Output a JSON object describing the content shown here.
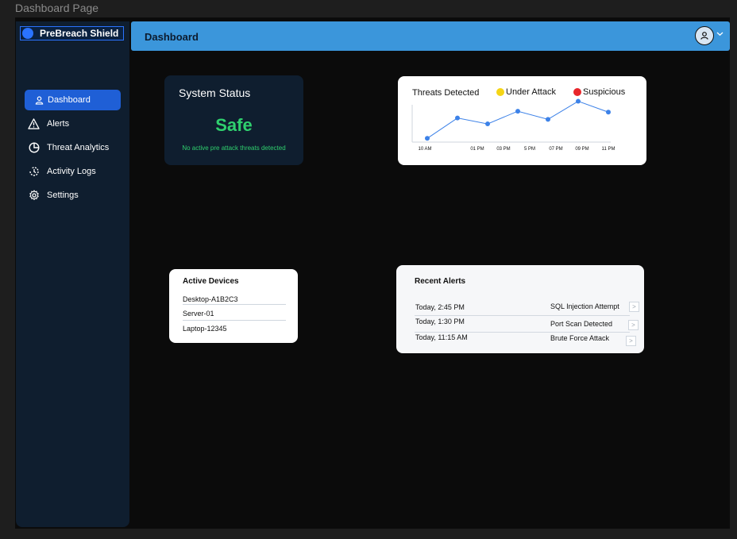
{
  "page_label": "Dashboard Page",
  "app": {
    "logo_text": "PreBreach Shield"
  },
  "sidebar": {
    "items": [
      {
        "label": "Dashboard",
        "icon": "user-icon",
        "active": true
      },
      {
        "label": "Alerts",
        "icon": "warning-icon"
      },
      {
        "label": "Threat Analytics",
        "icon": "pie-chart-icon"
      },
      {
        "label": "Activity Logs",
        "icon": "history-icon"
      },
      {
        "label": "Settings",
        "icon": "gear-icon"
      }
    ]
  },
  "topbar": {
    "title": "Dashboard"
  },
  "status_card": {
    "title": "System Status",
    "value": "Safe",
    "description": "No active pre attack threats detected",
    "accent": "#2fd06e"
  },
  "threats_card": {
    "title": "Threats Detected",
    "legend": [
      {
        "label": "Under Attack",
        "color": "#f5d516"
      },
      {
        "label": "Suspicious",
        "color": "#e8262b"
      }
    ]
  },
  "chart_data": {
    "type": "line",
    "title": "Threats Detected",
    "categories": [
      "10 AM",
      "01 PM",
      "03 PM",
      "5 PM",
      "07 PM",
      "09 PM",
      "11 PM"
    ],
    "x": [
      "10 AM",
      "",
      "01 PM",
      "03 PM",
      "5 PM",
      "07 PM",
      "09 PM",
      "11 PM"
    ],
    "series": [
      {
        "values": [
          1,
          5.5,
          4.2,
          7,
          5.2,
          9.2,
          6.8
        ],
        "color": "#3d82e8"
      }
    ],
    "ylim": [
      0,
      10
    ],
    "grid": false,
    "legend_placement": "top"
  },
  "devices_card": {
    "title": "Active Devices",
    "devices": [
      "Desktop-A1B2C3",
      "Server-01",
      "Laptop-12345"
    ]
  },
  "alerts_card": {
    "title": "Recent Alerts",
    "rows": [
      {
        "time": "Today, 2:45 PM",
        "name": "SQL Injection Attempt"
      },
      {
        "time": "Today, 1:30 PM",
        "name": "Port Scan Detected"
      },
      {
        "time": "Today, 11:15 AM",
        "name": "Brute Force Attack"
      }
    ],
    "row_action": ">"
  }
}
